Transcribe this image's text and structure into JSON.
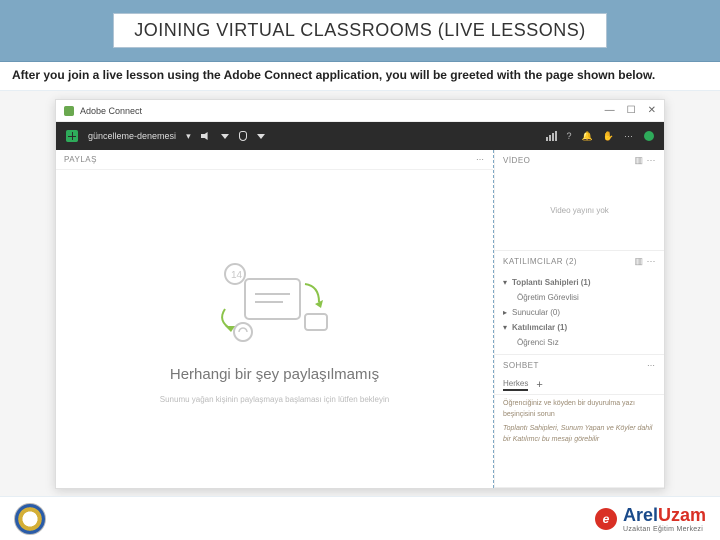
{
  "slide": {
    "title": "JOINING VIRTUAL CLASSROOMS (LIVE LESSONS)",
    "caption": "After you join a live lesson using the Adobe Connect application, you will be greeted with the page shown below."
  },
  "window": {
    "app_name": "Adobe Connect",
    "minimize": "—",
    "maximize": "☐",
    "close": "✕"
  },
  "toolbar": {
    "room_name": "güncelleme-denemesi",
    "dropdown_glyph": "▾"
  },
  "left_pane": {
    "header": "PAYLAŞ",
    "ellipsis": "⋯",
    "empty_title": "Herhangi bir şey paylaşılmamış",
    "empty_sub": "Sunumu yağan kişinin paylaşmaya başlaması için lütfen bekleyin"
  },
  "video_panel": {
    "header": "VİDEO",
    "empty": "Video yayını yok"
  },
  "participants_panel": {
    "header": "KATILIMCILAR (2)",
    "host_header": "Toplantı Sahipleri (1)",
    "host_name": "Öğretim Görevlisi",
    "presenters_header": "Sunucular (0)",
    "attendees_header": "Katılımcılar (1)",
    "attendee_name": "Öğrenci   Sız"
  },
  "chat_panel": {
    "header": "SOHBET",
    "tab": "Herkes",
    "plus": "+",
    "line1": "Öğrenciğiniz ve köyden bir duyurulma yazı beşinçisini sorun",
    "line2": "Toplantı Sahipleri, Sunum Yapan ve Köyler dahil bir Katılımcı bu mesajı görebilir"
  },
  "footer": {
    "brand_main": "Arel",
    "brand_accent": "Uzam",
    "brand_sub": "Uzaktan Eğitim Merkezi",
    "e": "e"
  }
}
